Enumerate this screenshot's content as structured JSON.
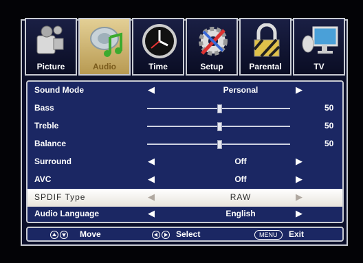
{
  "tabs": [
    {
      "label": "Picture",
      "icon": "camera-icon"
    },
    {
      "label": "Audio",
      "icon": "music-note-icon",
      "active": true
    },
    {
      "label": "Time",
      "icon": "clock-icon"
    },
    {
      "label": "Setup",
      "icon": "gear-wrench-icon"
    },
    {
      "label": "Parental",
      "icon": "padlock-icon"
    },
    {
      "label": "TV",
      "icon": "satellite-monitor-icon"
    }
  ],
  "menu": {
    "arrow_left": "◀",
    "arrow_right": "▶",
    "items": [
      {
        "label": "Sound Mode",
        "value": "Personal",
        "type": "select"
      },
      {
        "label": "Bass",
        "value": "50",
        "type": "slider",
        "level": 0.5
      },
      {
        "label": "Treble",
        "value": "50",
        "type": "slider",
        "level": 0.5
      },
      {
        "label": "Balance",
        "value": "50",
        "type": "slider",
        "level": 0.5
      },
      {
        "label": "Surround",
        "value": "Off",
        "type": "select"
      },
      {
        "label": "AVC",
        "value": "Off",
        "type": "select"
      },
      {
        "label": "SPDIF Type",
        "value": "RAW",
        "type": "select",
        "selected": true
      },
      {
        "label": "Audio Language",
        "value": "English",
        "type": "select"
      }
    ]
  },
  "footer": {
    "move": "Move",
    "select": "Select",
    "menu_key": "MENU",
    "exit": "Exit"
  },
  "colors": {
    "panel": "#1b2763",
    "active_tab": "#d6bf80",
    "highlight": "#ffffff"
  }
}
